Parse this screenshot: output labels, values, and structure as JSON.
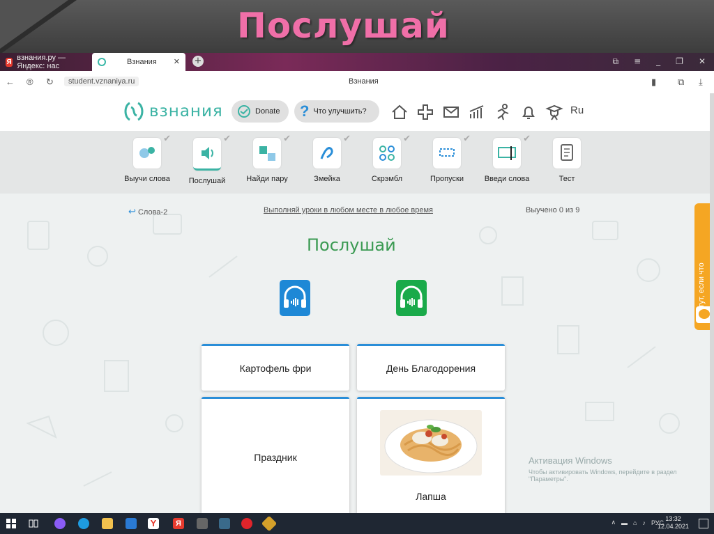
{
  "slide": {
    "title": "Послушай"
  },
  "browser": {
    "tabs": [
      {
        "label": "взнания.ру — Яндекс: нас"
      },
      {
        "label": "Взнания"
      }
    ],
    "url": "student.vznaniya.ru",
    "page_title": "Взнания"
  },
  "site": {
    "logo_text": "взнания",
    "donate_label": "Donate",
    "improve_label": "Что улучшить?",
    "lang": "Ru",
    "header_icons": [
      "home-icon",
      "plus-icon",
      "mail-icon",
      "stats-icon",
      "runner-icon",
      "bell-icon",
      "graduate-icon"
    ]
  },
  "lessons": [
    {
      "label": "Выучи слова",
      "done": true
    },
    {
      "label": "Послушай",
      "done": true,
      "active": true
    },
    {
      "label": "Найди пару",
      "done": true
    },
    {
      "label": "Змейка",
      "done": true
    },
    {
      "label": "Скрэмбл",
      "done": true
    },
    {
      "label": "Пропуски",
      "done": true
    },
    {
      "label": "Введи слова",
      "done": true
    },
    {
      "label": "Тест",
      "done": false
    }
  ],
  "nav": {
    "back_label": "Слова-2",
    "motto": "Выполняй уроки в любом месте в любое время",
    "progress": "Выучено 0 из 9"
  },
  "exercise": {
    "heading": "Послушай",
    "cards": [
      {
        "label": "Картофель фри"
      },
      {
        "label": "День Благодорения"
      },
      {
        "label": "Праздник"
      },
      {
        "label": "Лапша",
        "has_image": true
      }
    ]
  },
  "feedback_tab": "Мы тут, если что",
  "windows_activation": {
    "title": "Активация Windows",
    "subtitle": "Чтобы активировать Windows, перейдите в раздел \"Параметры\"."
  },
  "taskbar": {
    "lang": "РУС",
    "time": "13:32",
    "date": "12.04.2021"
  },
  "colors": {
    "accent": "#3bb3a4",
    "title_pink": "#f06fa8",
    "card_border": "#2a8ed8",
    "heading_green": "#3a9a52"
  }
}
